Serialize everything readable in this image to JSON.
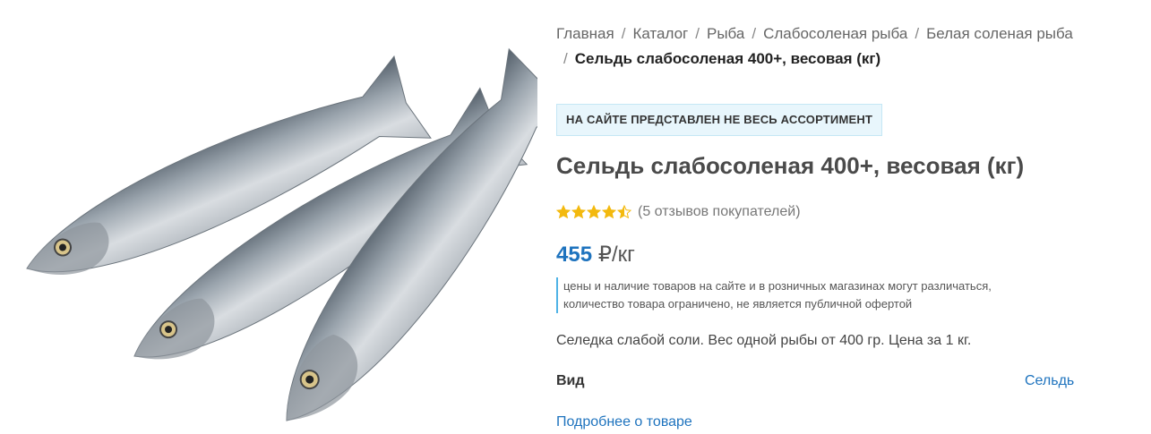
{
  "breadcrumb": {
    "items": [
      "Главная",
      "Каталог",
      "Рыба",
      "Слабосоленая рыба",
      "Белая соленая рыба"
    ],
    "current": "Сельдь слабосоленая 400+, весовая (кг)"
  },
  "notice": "НА САЙТЕ ПРЕДСТАВЛЕН НЕ ВЕСЬ АССОРТИМЕНТ",
  "product": {
    "title": "Сельдь слабосоленая 400+, весовая (кг)",
    "rating": 4.5,
    "reviews_text": "(5 отзывов покупателей)",
    "price_value": "455",
    "price_unit": "₽/кг",
    "price_note_line1": "цены и наличие товаров на сайте и в розничных магазинах могут различаться,",
    "price_note_line2": "количество товара ограничено, не является публичной офертой",
    "description": "Селедка слабой соли. Вес одной рыбы от 400 гр. Цена за 1 кг.",
    "attribute_label": "Вид",
    "attribute_value": "Сельдь",
    "more_link": "Подробнее о товаре"
  },
  "colors": {
    "accent": "#1e73be",
    "star": "#f3b90e",
    "notice_bg": "#e8f6fc"
  }
}
